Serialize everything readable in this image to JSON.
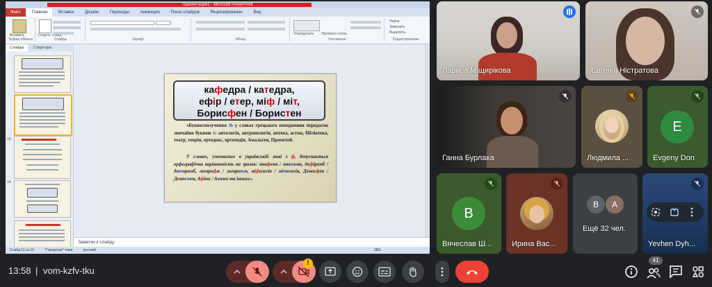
{
  "powerpoint": {
    "title_bar": "Презентация1 - Microsoft PowerPoint",
    "tabs": [
      "Файл",
      "Главная",
      "Вставка",
      "Дизайн",
      "Переходы",
      "Анимация",
      "Показ слайдов",
      "Рецензирование",
      "Вид"
    ],
    "ribbon_groups": [
      "Буфер обмена",
      "Слайды",
      "Шрифт",
      "Абзац",
      "Рисование",
      "Редактирование"
    ],
    "ribbon_buttons": {
      "paste": "Вставить",
      "create_slide": "Создать слайд",
      "find": "Найти",
      "replace": "Заменить",
      "select": "Выделить",
      "arrange": "Упорядочить",
      "quick_styles": "Экспресс-стили"
    },
    "panel_tabs": [
      "Слайды",
      "Структура"
    ],
    "thumbnail_numbers": [
      "11",
      "12",
      "13",
      "14"
    ],
    "notes_placeholder": "Заметки к слайду",
    "status": {
      "slide": "Слайд 11 из 19",
      "theme": "\"Городская\" тема",
      "language": "русский",
      "zoom": "38%"
    }
  },
  "slide": {
    "title_lines": [
      [
        "ка",
        "ф",
        "едра / ка",
        "т",
        "едра,"
      ],
      [
        "еф",
        "і",
        "р / е",
        "т",
        "ер, мі",
        "ф",
        " / мі",
        "т",
        ","
      ],
      [
        "Борис",
        "ф",
        "ен / Борис",
        "т",
        "ен"
      ]
    ],
    "para1": [
      {
        "t": "«Буквосполучення ",
        "c": ""
      },
      {
        "t": "th",
        "c": "blue"
      },
      {
        "t": " у словах грецького походження передаємо звичайно буквою ",
        "c": ""
      },
      {
        "t": "т",
        "c": "blue"
      },
      {
        "t": ": антологія, антропологія, аптека, астма, бібліотека, театр, теорія, ортодокс, ортопедія, Амальтея, Прометей.",
        "c": ""
      }
    ],
    "para2": [
      {
        "t": "У словах, узвичаєних в українській мові з ",
        "c": ""
      },
      {
        "t": "ф",
        "c": "red"
      },
      {
        "t": ", допускається орфографічна варіантність на зразок: ана",
        "c": ""
      },
      {
        "t": "ф",
        "c": "red"
      },
      {
        "t": "ема / ана",
        "c": ""
      },
      {
        "t": "т",
        "c": "blue"
      },
      {
        "t": "ема, ди",
        "c": ""
      },
      {
        "t": "ф",
        "c": "red"
      },
      {
        "t": "ірамб / ди",
        "c": ""
      },
      {
        "t": "т",
        "c": "blue"
      },
      {
        "t": "ирамб, логари",
        "c": ""
      },
      {
        "t": "ф",
        "c": "red"
      },
      {
        "t": "м / логари",
        "c": ""
      },
      {
        "t": "т",
        "c": "blue"
      },
      {
        "t": "м, мі",
        "c": ""
      },
      {
        "t": "ф",
        "c": "red"
      },
      {
        "t": "ологія / мі",
        "c": ""
      },
      {
        "t": "т",
        "c": "blue"
      },
      {
        "t": "ологія, Демос",
        "c": ""
      },
      {
        "t": "ф",
        "c": "red"
      },
      {
        "t": "ен / Демос",
        "c": ""
      },
      {
        "t": "т",
        "c": "blue"
      },
      {
        "t": "ен, А",
        "c": ""
      },
      {
        "t": "ф",
        "c": "red"
      },
      {
        "t": "іни / А",
        "c": ""
      },
      {
        "t": "т",
        "c": "blue"
      },
      {
        "t": "ени та інших».",
        "c": ""
      }
    ]
  },
  "meet": {
    "participants": [
      {
        "name": "Лариса Міщирікова"
      },
      {
        "name": "Євгенія Ністратова"
      },
      {
        "name": "Ганна Бурлака"
      },
      {
        "name": "Людмила ..."
      },
      {
        "name": "Evgeny Don",
        "initial": "E"
      },
      {
        "name": "Вячеслав Ш...",
        "initial": "В"
      },
      {
        "name": "Ирина Вас..."
      },
      {
        "name": "Ещё 32 чел.",
        "initials": [
          "B",
          "A"
        ]
      },
      {
        "name": "Yevhen Dyh..."
      }
    ],
    "time": "13:58",
    "separator": "|",
    "meeting_code": "vom-kzfv-tku",
    "participant_count": "41",
    "camera_warning": "!",
    "colors": {
      "tile": "#3c4043",
      "green_avatar": "#3b8b3b",
      "evgeny_avatar": "#2e8b3f",
      "hangup": "#ea4335",
      "muted": "#5c2b29",
      "selfview": "#1e3a5f"
    }
  }
}
